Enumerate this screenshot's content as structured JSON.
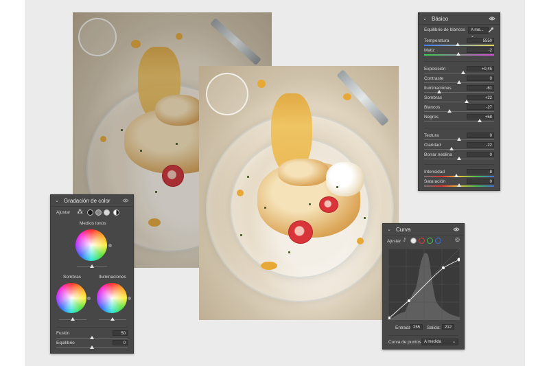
{
  "basic_panel": {
    "title": "Básico",
    "white_balance_label": "Equilibrio de blancos",
    "white_balance_value": "A me...",
    "sliders": [
      {
        "label": "Temperatura",
        "value": "5550",
        "level": 0.48
      },
      {
        "label": "Matiz",
        "value": "-2",
        "level": 0.49
      },
      {
        "label": "Exposición",
        "value": "+0,45",
        "level": 0.56
      },
      {
        "label": "Contraste",
        "value": "0",
        "level": 0.5
      },
      {
        "label": "Iluminaciones",
        "value": "-61",
        "level": 0.22
      },
      {
        "label": "Sombras",
        "value": "+22",
        "level": 0.61
      },
      {
        "label": "Blancos",
        "value": "-27",
        "level": 0.36
      },
      {
        "label": "Negros",
        "value": "+58",
        "level": 0.79
      },
      {
        "label": "Textura",
        "value": "0",
        "level": 0.5
      },
      {
        "label": "Claridad",
        "value": "-22",
        "level": 0.39
      },
      {
        "label": "Borrar neblina",
        "value": "0",
        "level": 0.5
      },
      {
        "label": "Intensidad",
        "value": "-8",
        "level": 0.46
      },
      {
        "label": "Saturación",
        "value": "0",
        "level": 0.5
      }
    ]
  },
  "grading_panel": {
    "title": "Gradación de color",
    "adjust_label": "Ajustar",
    "midtones_label": "Medios tonos",
    "shadows_label": "Sombras",
    "highlights_label": "Iluminaciones",
    "blend_label": "Fusión",
    "blend_value": "50",
    "balance_label": "Equilibrio",
    "balance_value": "0"
  },
  "curve_panel": {
    "title": "Curva",
    "adjust_label": "Ajustar",
    "input_label": "Entrada:",
    "input_value": "255",
    "output_label": "Salida:",
    "output_value": "212",
    "point_curve_label": "Curva de puntos",
    "point_curve_value": "A medida"
  },
  "colors": {
    "panel_bg": "#474747",
    "canvas_bg": "#ebebeb"
  }
}
